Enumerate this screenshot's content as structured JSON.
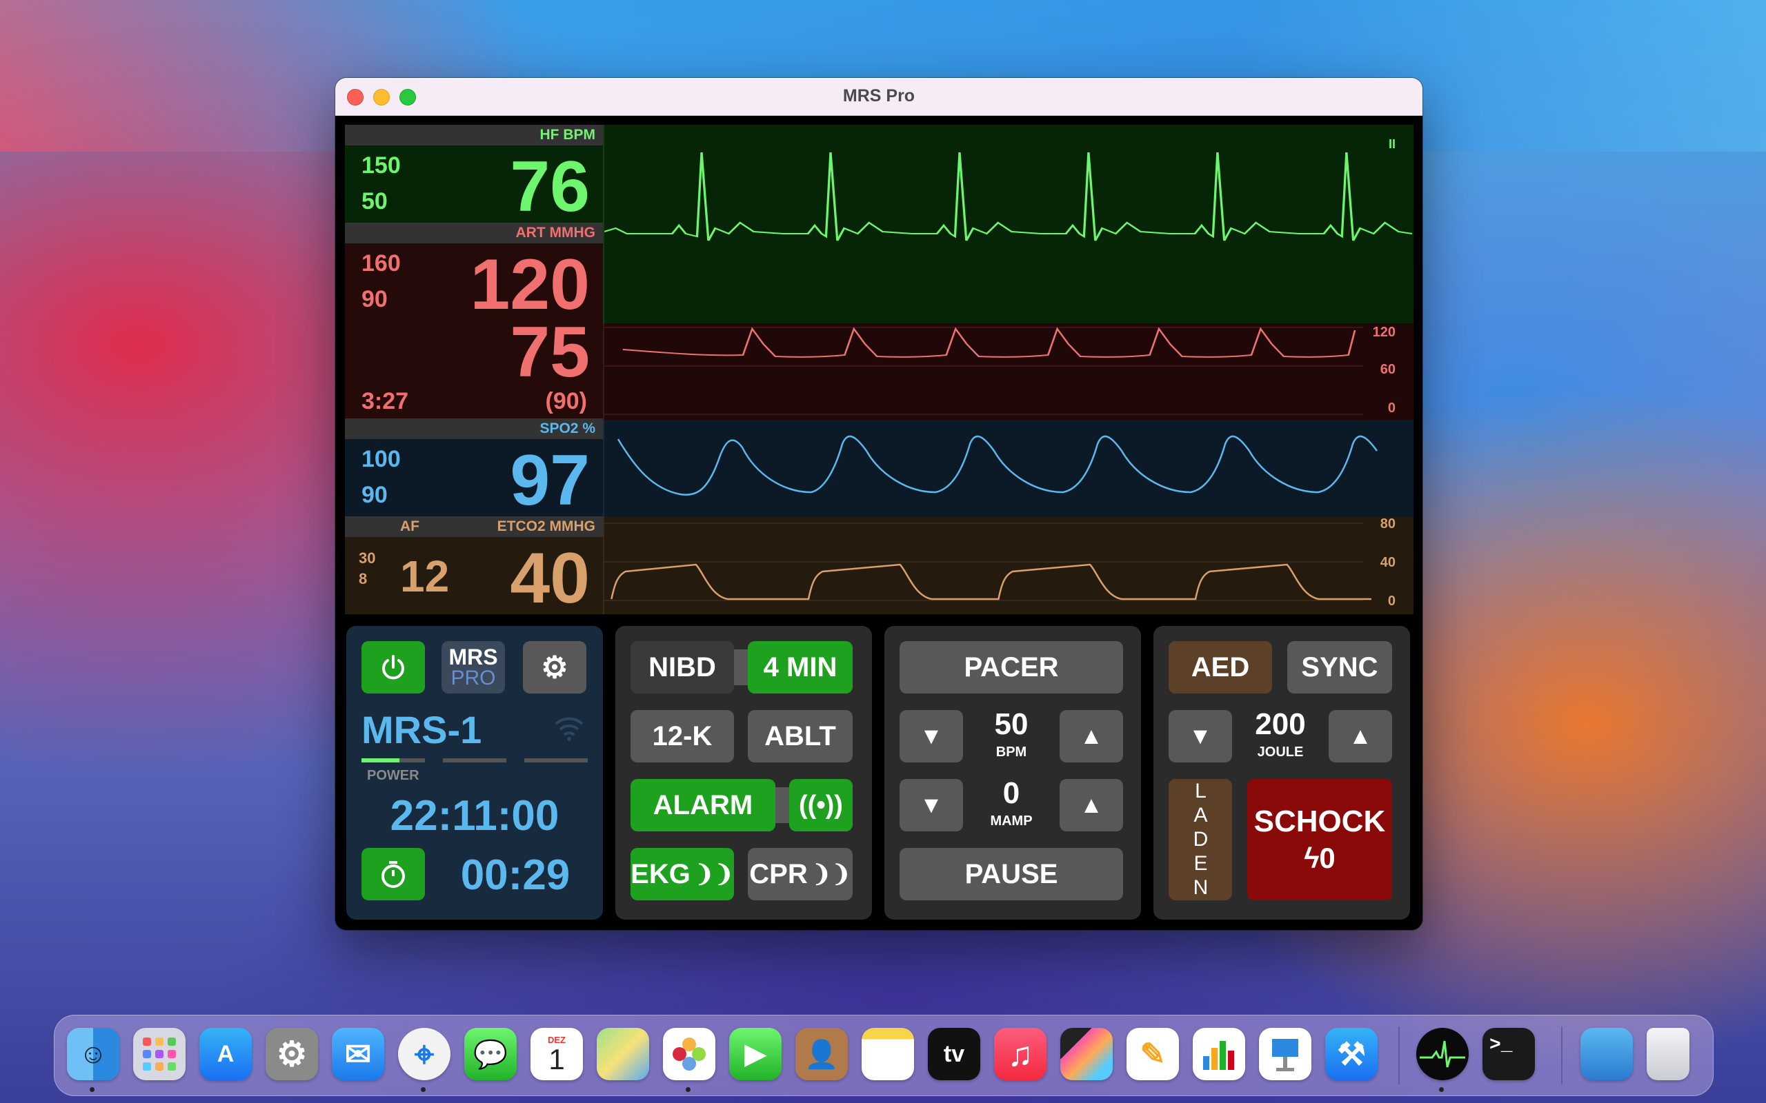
{
  "window": {
    "title": "MRS Pro"
  },
  "hf": {
    "header": "HF  BPM",
    "upper": "150",
    "lower": "50",
    "value": "76"
  },
  "art": {
    "header": "ART  MMHG",
    "upper": "160",
    "lower": "90",
    "systolic": "120",
    "diastolic": "75",
    "time": "3:27",
    "mean": "(90)",
    "scale": [
      "120",
      "60",
      "0"
    ]
  },
  "spo2": {
    "header": "SPO2  %",
    "upper": "100",
    "lower": "90",
    "value": "97"
  },
  "etco2": {
    "af_label": "AF",
    "header": "ETCO2  MMHG",
    "af_upper": "30",
    "af_lower": "8",
    "af_value": "12",
    "value": "40",
    "scale": [
      "80",
      "40",
      "0"
    ]
  },
  "waveform": {
    "pause_glyph": "II"
  },
  "panel1": {
    "logo_top": "MRS",
    "logo_bottom": "PRO",
    "device": "MRS-1",
    "power_label": "POWER",
    "clock": "22:11:00",
    "timer": "00:29"
  },
  "panel2": {
    "nibd": "NIBD",
    "interval": "4 MIN",
    "twelve_k": "12-K",
    "ablt": "ABLT",
    "alarm": "ALARM",
    "ekg": "EKG",
    "cpr": "CPR"
  },
  "panel3": {
    "pacer": "PACER",
    "rate": "50",
    "rate_unit": "BPM",
    "current": "0",
    "current_unit": "MAMP",
    "pause": "PAUSE"
  },
  "panel4": {
    "aed": "AED",
    "sync": "SYNC",
    "energy": "200",
    "energy_unit": "JOULE",
    "laden": "LADEN",
    "schock": "SCHOCK",
    "schock_count": "ϟ0"
  },
  "colors": {
    "hf": "#6ef56e",
    "art": "#f07070",
    "spo2": "#5ab8ee",
    "etco2": "#d8a06a"
  },
  "dock": [
    {
      "name": "finder",
      "label": ""
    },
    {
      "name": "launchpad",
      "label": ""
    },
    {
      "name": "app-store",
      "label": "A"
    },
    {
      "name": "system-preferences",
      "label": "⚙"
    },
    {
      "name": "mail",
      "label": "✉"
    },
    {
      "name": "safari",
      "label": "⌖"
    },
    {
      "name": "messages",
      "label": "💬"
    },
    {
      "name": "calendar",
      "label": "1",
      "sub": "DEZ"
    },
    {
      "name": "maps",
      "label": ""
    },
    {
      "name": "photos",
      "label": ""
    },
    {
      "name": "facetime",
      "label": "▶"
    },
    {
      "name": "contacts",
      "label": "👤"
    },
    {
      "name": "notes",
      "label": ""
    },
    {
      "name": "apple-tv",
      "label": "tv"
    },
    {
      "name": "music",
      "label": "♫"
    },
    {
      "name": "final-cut",
      "label": ""
    },
    {
      "name": "pages",
      "label": "✎"
    },
    {
      "name": "numbers",
      "label": ""
    },
    {
      "name": "keynote",
      "label": ""
    },
    {
      "name": "xcode",
      "label": "⚒"
    },
    {
      "name": "mrs-pro",
      "label": ""
    },
    {
      "name": "terminal",
      "label": ">_"
    },
    {
      "name": "preview",
      "label": ""
    },
    {
      "name": "trash",
      "label": ""
    }
  ]
}
